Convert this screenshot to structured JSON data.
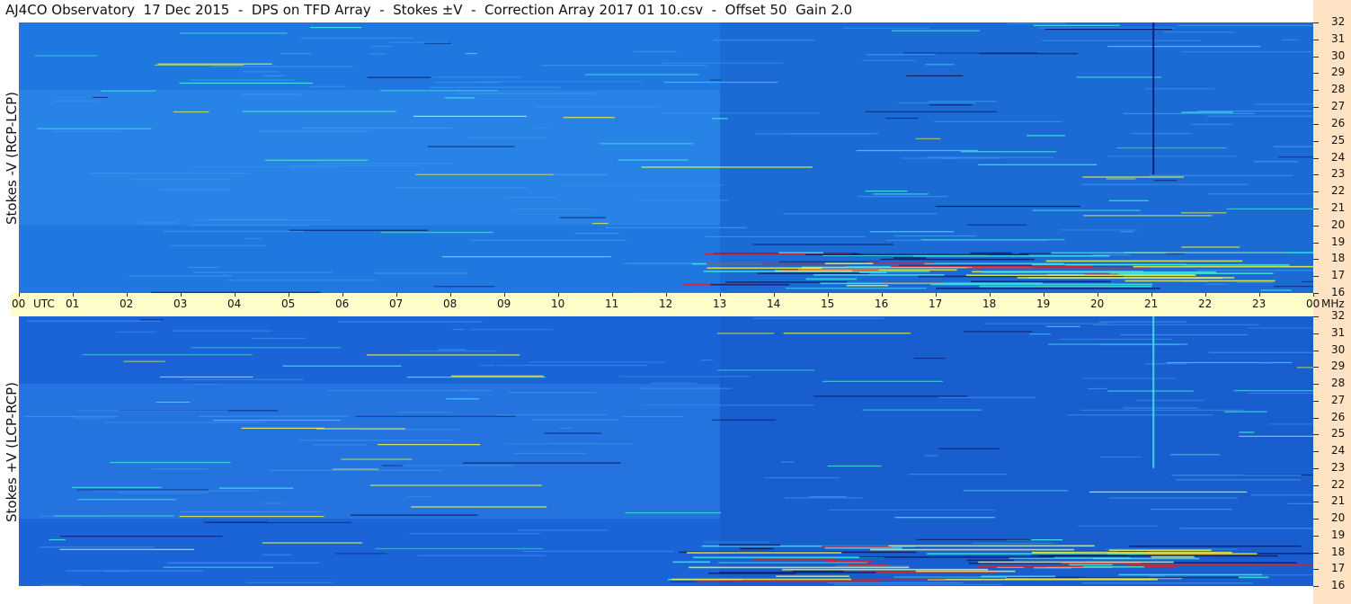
{
  "title": "AJ4CO Observatory  17 Dec 2015  -  DPS on TFD Array  -  Stokes ±V  -  Correction Array 2017 01 10.csv  -  Offset 50  Gain 2.0",
  "chart_data": [
    {
      "type": "heatmap",
      "ylabel": "Stokes -V (RCP-LCP)",
      "x_unit_label": "UTC",
      "y_unit_label": "MHz",
      "x_ticks": [
        "00",
        "01",
        "02",
        "03",
        "04",
        "05",
        "06",
        "07",
        "08",
        "09",
        "10",
        "11",
        "12",
        "13",
        "14",
        "15",
        "16",
        "17",
        "18",
        "19",
        "20",
        "21",
        "22",
        "23",
        "00"
      ],
      "y_ticks": [
        "16",
        "17",
        "18",
        "19",
        "20",
        "21",
        "22",
        "23",
        "24",
        "25",
        "26",
        "27",
        "28",
        "29",
        "30",
        "31",
        "32"
      ],
      "xlim_hours": [
        0,
        24
      ],
      "ylim_mhz": [
        16,
        32
      ],
      "colors": {
        "base": "#1f78e0",
        "light": "#3a98f0",
        "cyan": "#40e8e0",
        "yellow": "#f0f040",
        "dark": "#0a1e6a",
        "red": "#e02020"
      }
    },
    {
      "type": "heatmap",
      "ylabel": "Stokes +V (LCP-RCP)",
      "x_unit_label": "UTC",
      "y_unit_label": "MHz",
      "x_ticks": [
        "00",
        "01",
        "02",
        "03",
        "04",
        "05",
        "06",
        "07",
        "08",
        "09",
        "10",
        "11",
        "12",
        "13",
        "14",
        "15",
        "16",
        "17",
        "18",
        "19",
        "20",
        "21",
        "22",
        "23",
        "00"
      ],
      "y_ticks": [
        "16",
        "17",
        "18",
        "19",
        "20",
        "21",
        "22",
        "23",
        "24",
        "25",
        "26",
        "27",
        "28",
        "29",
        "30",
        "31",
        "32"
      ],
      "xlim_hours": [
        0,
        24
      ],
      "ylim_mhz": [
        16,
        32
      ],
      "colors": {
        "base": "#1a64d8",
        "light": "#3a90ea",
        "cyan": "#40e8e0",
        "yellow": "#f0f040",
        "dark": "#0a1e6a",
        "red": "#e02020"
      }
    }
  ]
}
